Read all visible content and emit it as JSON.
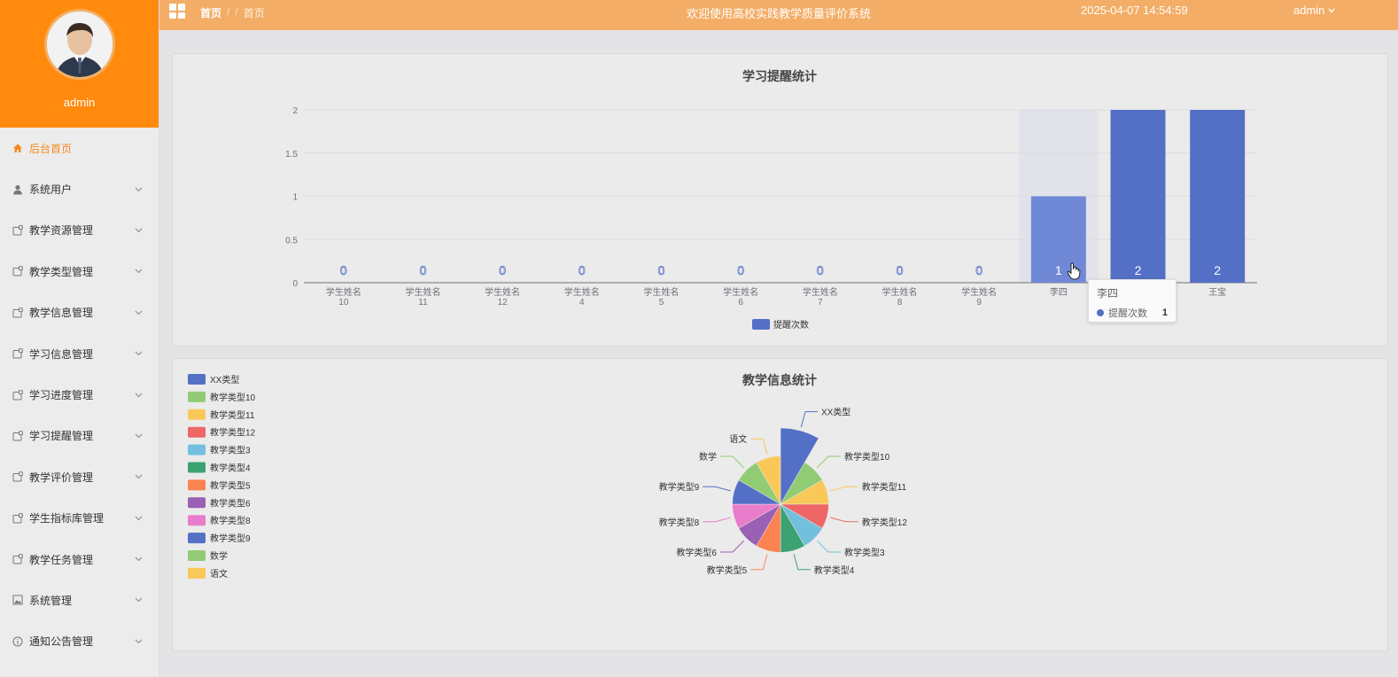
{
  "sidebar": {
    "username": "admin",
    "menu": [
      {
        "label": "后台首页",
        "icon": "home-icon",
        "active": true
      },
      {
        "label": "系统用户",
        "icon": "user-icon"
      },
      {
        "label": "教学资源管理",
        "icon": "folder-icon"
      },
      {
        "label": "教学类型管理",
        "icon": "folder-icon"
      },
      {
        "label": "教学信息管理",
        "icon": "folder-icon"
      },
      {
        "label": "学习信息管理",
        "icon": "folder-icon"
      },
      {
        "label": "学习进度管理",
        "icon": "folder-icon"
      },
      {
        "label": "学习提醒管理",
        "icon": "folder-icon"
      },
      {
        "label": "教学评价管理",
        "icon": "folder-icon"
      },
      {
        "label": "学生指标库管理",
        "icon": "folder-icon"
      },
      {
        "label": "教学任务管理",
        "icon": "folder-icon"
      },
      {
        "label": "系统管理",
        "icon": "image-icon"
      },
      {
        "label": "通知公告管理",
        "icon": "info-icon"
      }
    ]
  },
  "header": {
    "breadcrumb_home": "首页",
    "breadcrumb_sep": "/",
    "breadcrumb_current": "首页",
    "title": "欢迎使用高校实践教学质量评价系统",
    "datetime": "2025-04-07 14:54:59",
    "user": "admin"
  },
  "colors": {
    "accent": "#ff8a0d",
    "header": "#f3ad66",
    "bar": "#5470c6"
  },
  "tooltip": {
    "title": "李四",
    "series": "提醒次数",
    "value": "1"
  },
  "chart_data": [
    {
      "type": "bar",
      "title": "学习提醒统计",
      "categories": [
        "学生姓名10",
        "学生姓名11",
        "学生姓名12",
        "学生姓名4",
        "学生姓名5",
        "学生姓名6",
        "学生姓名7",
        "学生姓名8",
        "学生姓名9",
        "李四",
        "",
        "王宝"
      ],
      "category_lines": [
        [
          "学生姓名",
          "10"
        ],
        [
          "学生姓名",
          "11"
        ],
        [
          "学生姓名",
          "12"
        ],
        [
          "学生姓名",
          "4"
        ],
        [
          "学生姓名",
          "5"
        ],
        [
          "学生姓名",
          "6"
        ],
        [
          "学生姓名",
          "7"
        ],
        [
          "学生姓名",
          "8"
        ],
        [
          "学生姓名",
          "9"
        ],
        [
          "李四"
        ],
        [
          ""
        ],
        [
          "王宝"
        ]
      ],
      "series": [
        {
          "name": "提醒次数",
          "values": [
            0,
            0,
            0,
            0,
            0,
            0,
            0,
            0,
            0,
            1,
            2,
            2
          ]
        }
      ],
      "yticks": [
        "0",
        "0.5",
        "1",
        "1.5",
        "2"
      ],
      "ylim": [
        0,
        2
      ],
      "highlight_index": 9,
      "legend_position": "bottom"
    },
    {
      "type": "pie",
      "subtype": "rose",
      "title": "教学信息统计",
      "labels": [
        "XX类型",
        "教学类型10",
        "教学类型11",
        "教学类型12",
        "教学类型3",
        "教学类型4",
        "教学类型5",
        "教学类型6",
        "教学类型8",
        "教学类型9",
        "数学",
        "语文"
      ],
      "values": [
        4,
        1.6,
        1.6,
        1.6,
        1.6,
        1.6,
        1.6,
        1.6,
        1.6,
        1.6,
        1.6,
        1.6
      ],
      "colors": [
        "#5470c6",
        "#91cc75",
        "#fac858",
        "#ee6666",
        "#73c0de",
        "#3ba272",
        "#fc8452",
        "#9a60b4",
        "#ea7ccc",
        "#5470c6",
        "#91cc75",
        "#fac858"
      ],
      "legend_position": "top-left"
    }
  ]
}
